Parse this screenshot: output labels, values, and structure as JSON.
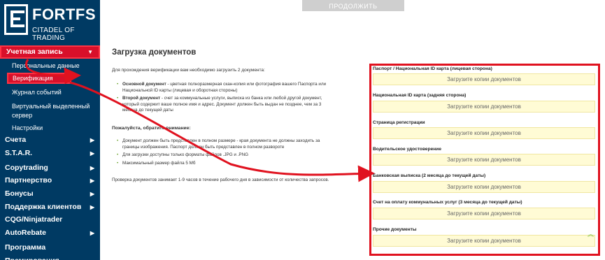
{
  "brand": {
    "name": "FORTFS",
    "tagline": "CITADEL OF TRADING"
  },
  "sidebar": {
    "account_label": "Учетная запись",
    "submenu": [
      {
        "label": "Персональные данные"
      },
      {
        "label": "Верификация"
      },
      {
        "label": "Журнал событий"
      },
      {
        "label": "Виртуальный выделенный сервер"
      },
      {
        "label": "Настройки"
      }
    ],
    "items": [
      {
        "label": "Счета",
        "has_arrow": true
      },
      {
        "label": "S.T.A.R.",
        "has_arrow": true
      },
      {
        "label": "Copytrading",
        "has_arrow": true
      },
      {
        "label": "Партнерство",
        "has_arrow": true
      },
      {
        "label": "Бонусы",
        "has_arrow": true
      },
      {
        "label": "Поддержка клиентов",
        "has_arrow": true
      },
      {
        "label": "CQG/Ninjatrader",
        "has_arrow": false
      },
      {
        "label": "AutoRebate",
        "has_arrow": true
      },
      {
        "label": "Программа Премирования",
        "has_arrow": false
      }
    ]
  },
  "top": {
    "continue_label": "ПРОДОЛЖИТЬ"
  },
  "main": {
    "title": "Загрузка документов",
    "intro": "Для прохождения верификации вам необходимо загрузить 2 документа:",
    "docs": [
      {
        "bold": "Основной документ",
        "text": " - цветная полноразмерная скан-копия или фотография вашего Паспорта или Национальной ID карты (лицевая и оборотная стороны)"
      },
      {
        "bold": "Второй документ",
        "text": " - счет за коммунальные услуги, выписка из банка или любой другой документ, который содержит ваше полное имя и адрес. Документ должен быть выдан не позднее, чем за 3 месяца до текущей даты"
      }
    ],
    "attention": "Пожалуйста, обратите внимание:",
    "notes": [
      "Документ должен быть представлен в полном размере - края документа не должны заходить за границы изображения. Паспорт должен быть представлен в полном развороте",
      "Для загрузки доступны только форматы файлов .JPG и .PNG",
      "Максимальный размер файла 5 Мб"
    ],
    "footer": "Проверка документов занимает 1-9 часов в течение рабочего дня в зависимости от количества запросов."
  },
  "uploads": {
    "button_label": "Загрузите копии документов",
    "fields": [
      {
        "label": "Паспорт / Национальная ID карта (лицевая сторона)"
      },
      {
        "label": "Национальная ID карта (задняя сторона)"
      },
      {
        "label": "Страница регистрации"
      },
      {
        "label": "Водительское удостоверение"
      },
      {
        "label": "Банковская выписка (2 месяца до текущей даты)"
      },
      {
        "label": "Счет на оплату коммунальных услуг (3 месяца до текущей даты)"
      },
      {
        "label": "Прочие документы"
      }
    ]
  },
  "colors": {
    "sidebar": "#003a63",
    "highlight": "#e0121f",
    "upload_bg": "#fffbd5"
  }
}
